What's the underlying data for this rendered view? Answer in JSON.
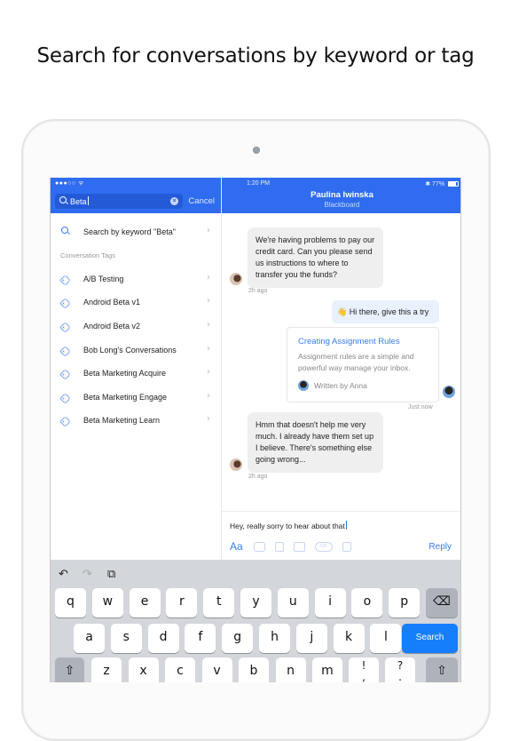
{
  "headline": "Search for conversations by keyword or tag",
  "status_bar": {
    "signal": "●●●○○ ᯤ",
    "time": "1:20 PM",
    "bluetooth": "✱",
    "battery_percent": "77%",
    "battery_level": 0.77
  },
  "search": {
    "query": "Beta",
    "cancel_label": "Cancel",
    "keyword_result": "Search by keyword \"Beta\"",
    "section_label": "Conversation Tags",
    "tags": [
      "A/B Testing",
      "Android Beta v1",
      "Android Beta v2",
      "Bob Long's Conversations",
      "Beta Marketing Acquire",
      "Beta Marketing Engage",
      "Beta Marketing Learn"
    ],
    "chevron": "›"
  },
  "conversation": {
    "contact_name": "Paulina Iwinska",
    "company": "Blackboard",
    "messages": [
      {
        "type": "incoming",
        "text": "We're having problems to pay our credit card. Can you please send us instructions to where to transfer you the funds?",
        "time": "2h ago"
      },
      {
        "type": "outgoing",
        "text": "👋 Hi there, give this a try"
      },
      {
        "type": "article",
        "title": "Creating Assignment Rules",
        "description": "Assignment rules are a simple and powerful way manage your inbox.",
        "author": "Written by Anna",
        "time": "Just now"
      },
      {
        "type": "incoming",
        "text": "Hmm that doesn't help me very much. I already have them set up I believe. There's something else going wrong...",
        "time": "2h ago"
      }
    ]
  },
  "composer": {
    "text": "Hey, really sorry to hear about that",
    "format_label": "Aa",
    "gif_label": "GIF",
    "reply_label": "Reply",
    "tools": [
      "text-format-icon",
      "inbox-icon",
      "bookmark-icon",
      "image-icon",
      "gif-icon",
      "note-icon"
    ]
  },
  "keyboard": {
    "toolbar": {
      "undo": "↶",
      "redo": "↷",
      "paste": "⧉"
    },
    "row1": [
      "q",
      "w",
      "e",
      "r",
      "t",
      "y",
      "u",
      "i",
      "o",
      "p"
    ],
    "row2": [
      "a",
      "s",
      "d",
      "f",
      "g",
      "h",
      "j",
      "k",
      "l"
    ],
    "row3": [
      "z",
      "x",
      "c",
      "v",
      "b",
      "n",
      "m"
    ],
    "punct1": "!\n,",
    "punct2": "?\n.",
    "backspace": "⌫",
    "shift": "⇧",
    "search_label": "Search"
  },
  "colors": {
    "brand_blue": "#2f6cf0",
    "link_blue": "#3b7cf0",
    "keyboard_search": "#157efb"
  }
}
